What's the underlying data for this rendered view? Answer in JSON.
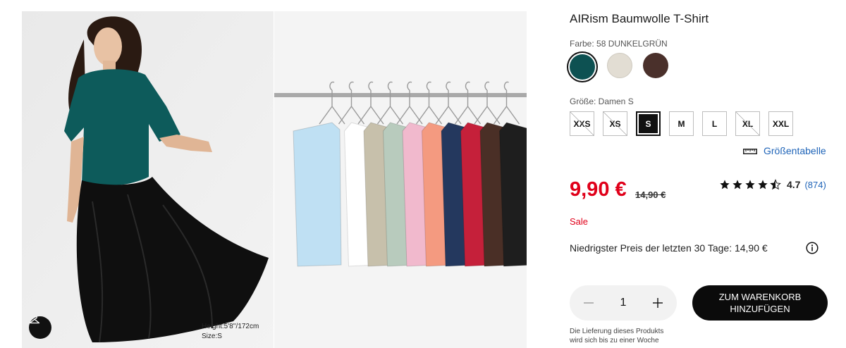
{
  "product": {
    "title": "AIRism Baumwolle T-Shirt"
  },
  "color": {
    "label": "Farbe: 58 DUNKELGRÜN",
    "swatches": [
      {
        "name": "dark-green",
        "hex": "#0d5152",
        "selected": true
      },
      {
        "name": "beige",
        "hex": "#e2ddd3",
        "selected": false
      },
      {
        "name": "brown",
        "hex": "#4a302b",
        "selected": false
      }
    ]
  },
  "size": {
    "label": "Größe: Damen S",
    "options": [
      {
        "label": "XXS",
        "state": "unavailable"
      },
      {
        "label": "XS",
        "state": "unavailable"
      },
      {
        "label": "S",
        "state": "selected"
      },
      {
        "label": "M",
        "state": "available"
      },
      {
        "label": "L",
        "state": "available"
      },
      {
        "label": "XL",
        "state": "unavailable"
      },
      {
        "label": "XXL",
        "state": "available"
      }
    ],
    "chart_link": "Größentabelle"
  },
  "pricing": {
    "price": "9,90 €",
    "old_price": "14,90 €",
    "sale_label": "Sale",
    "lowest_price_text": "Niedrigster Preis der letzten 30 Tage: 14,90 €"
  },
  "rating": {
    "stars": 4.5,
    "value": "4.7",
    "count": "(874)"
  },
  "purchase": {
    "quantity": "1",
    "cart_button_line1": "ZUM WARENKORB",
    "cart_button_line2": "HINZUFÜGEN"
  },
  "delivery": {
    "line1": "Die Lieferung dieses Produkts",
    "line2": "wird sich bis zu einer Woche"
  },
  "images": {
    "model_height": "Height:5'8''/172cm",
    "model_size": "Size:S",
    "hanging_shirt_colors": [
      "#bfe0f3",
      "#ffffff",
      "#c7c0ab",
      "#b8cbbd",
      "#f1b9cd",
      "#f49a80",
      "#24385e",
      "#c5203a",
      "#4a2f26",
      "#1e1e1e"
    ]
  },
  "colors": {
    "accent_red": "#e0001a",
    "link_blue": "#1f64b8",
    "button_black": "#0b0b0b"
  }
}
